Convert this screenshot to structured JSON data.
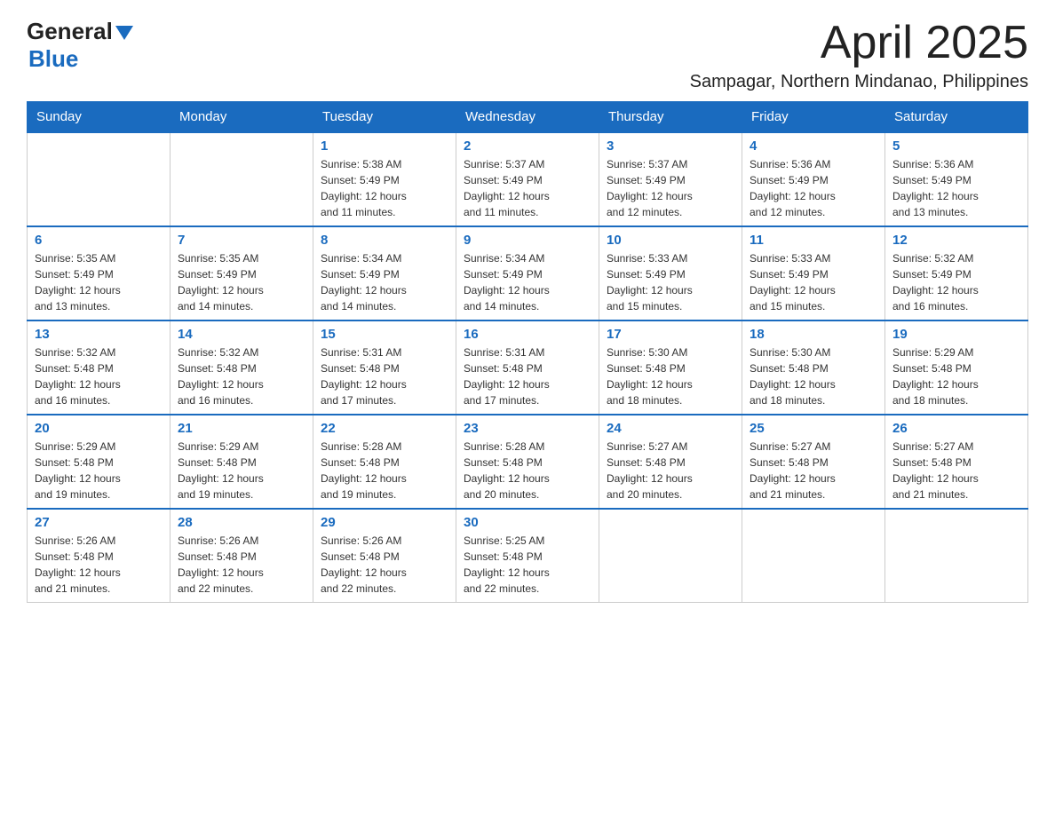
{
  "header": {
    "logo_general": "General",
    "logo_blue": "Blue",
    "month_title": "April 2025",
    "subtitle": "Sampagar, Northern Mindanao, Philippines"
  },
  "days_of_week": [
    "Sunday",
    "Monday",
    "Tuesday",
    "Wednesday",
    "Thursday",
    "Friday",
    "Saturday"
  ],
  "weeks": [
    [
      {
        "day": "",
        "info": ""
      },
      {
        "day": "",
        "info": ""
      },
      {
        "day": "1",
        "info": "Sunrise: 5:38 AM\nSunset: 5:49 PM\nDaylight: 12 hours\nand 11 minutes."
      },
      {
        "day": "2",
        "info": "Sunrise: 5:37 AM\nSunset: 5:49 PM\nDaylight: 12 hours\nand 11 minutes."
      },
      {
        "day": "3",
        "info": "Sunrise: 5:37 AM\nSunset: 5:49 PM\nDaylight: 12 hours\nand 12 minutes."
      },
      {
        "day": "4",
        "info": "Sunrise: 5:36 AM\nSunset: 5:49 PM\nDaylight: 12 hours\nand 12 minutes."
      },
      {
        "day": "5",
        "info": "Sunrise: 5:36 AM\nSunset: 5:49 PM\nDaylight: 12 hours\nand 13 minutes."
      }
    ],
    [
      {
        "day": "6",
        "info": "Sunrise: 5:35 AM\nSunset: 5:49 PM\nDaylight: 12 hours\nand 13 minutes."
      },
      {
        "day": "7",
        "info": "Sunrise: 5:35 AM\nSunset: 5:49 PM\nDaylight: 12 hours\nand 14 minutes."
      },
      {
        "day": "8",
        "info": "Sunrise: 5:34 AM\nSunset: 5:49 PM\nDaylight: 12 hours\nand 14 minutes."
      },
      {
        "day": "9",
        "info": "Sunrise: 5:34 AM\nSunset: 5:49 PM\nDaylight: 12 hours\nand 14 minutes."
      },
      {
        "day": "10",
        "info": "Sunrise: 5:33 AM\nSunset: 5:49 PM\nDaylight: 12 hours\nand 15 minutes."
      },
      {
        "day": "11",
        "info": "Sunrise: 5:33 AM\nSunset: 5:49 PM\nDaylight: 12 hours\nand 15 minutes."
      },
      {
        "day": "12",
        "info": "Sunrise: 5:32 AM\nSunset: 5:49 PM\nDaylight: 12 hours\nand 16 minutes."
      }
    ],
    [
      {
        "day": "13",
        "info": "Sunrise: 5:32 AM\nSunset: 5:48 PM\nDaylight: 12 hours\nand 16 minutes."
      },
      {
        "day": "14",
        "info": "Sunrise: 5:32 AM\nSunset: 5:48 PM\nDaylight: 12 hours\nand 16 minutes."
      },
      {
        "day": "15",
        "info": "Sunrise: 5:31 AM\nSunset: 5:48 PM\nDaylight: 12 hours\nand 17 minutes."
      },
      {
        "day": "16",
        "info": "Sunrise: 5:31 AM\nSunset: 5:48 PM\nDaylight: 12 hours\nand 17 minutes."
      },
      {
        "day": "17",
        "info": "Sunrise: 5:30 AM\nSunset: 5:48 PM\nDaylight: 12 hours\nand 18 minutes."
      },
      {
        "day": "18",
        "info": "Sunrise: 5:30 AM\nSunset: 5:48 PM\nDaylight: 12 hours\nand 18 minutes."
      },
      {
        "day": "19",
        "info": "Sunrise: 5:29 AM\nSunset: 5:48 PM\nDaylight: 12 hours\nand 18 minutes."
      }
    ],
    [
      {
        "day": "20",
        "info": "Sunrise: 5:29 AM\nSunset: 5:48 PM\nDaylight: 12 hours\nand 19 minutes."
      },
      {
        "day": "21",
        "info": "Sunrise: 5:29 AM\nSunset: 5:48 PM\nDaylight: 12 hours\nand 19 minutes."
      },
      {
        "day": "22",
        "info": "Sunrise: 5:28 AM\nSunset: 5:48 PM\nDaylight: 12 hours\nand 19 minutes."
      },
      {
        "day": "23",
        "info": "Sunrise: 5:28 AM\nSunset: 5:48 PM\nDaylight: 12 hours\nand 20 minutes."
      },
      {
        "day": "24",
        "info": "Sunrise: 5:27 AM\nSunset: 5:48 PM\nDaylight: 12 hours\nand 20 minutes."
      },
      {
        "day": "25",
        "info": "Sunrise: 5:27 AM\nSunset: 5:48 PM\nDaylight: 12 hours\nand 21 minutes."
      },
      {
        "day": "26",
        "info": "Sunrise: 5:27 AM\nSunset: 5:48 PM\nDaylight: 12 hours\nand 21 minutes."
      }
    ],
    [
      {
        "day": "27",
        "info": "Sunrise: 5:26 AM\nSunset: 5:48 PM\nDaylight: 12 hours\nand 21 minutes."
      },
      {
        "day": "28",
        "info": "Sunrise: 5:26 AM\nSunset: 5:48 PM\nDaylight: 12 hours\nand 22 minutes."
      },
      {
        "day": "29",
        "info": "Sunrise: 5:26 AM\nSunset: 5:48 PM\nDaylight: 12 hours\nand 22 minutes."
      },
      {
        "day": "30",
        "info": "Sunrise: 5:25 AM\nSunset: 5:48 PM\nDaylight: 12 hours\nand 22 minutes."
      },
      {
        "day": "",
        "info": ""
      },
      {
        "day": "",
        "info": ""
      },
      {
        "day": "",
        "info": ""
      }
    ]
  ]
}
